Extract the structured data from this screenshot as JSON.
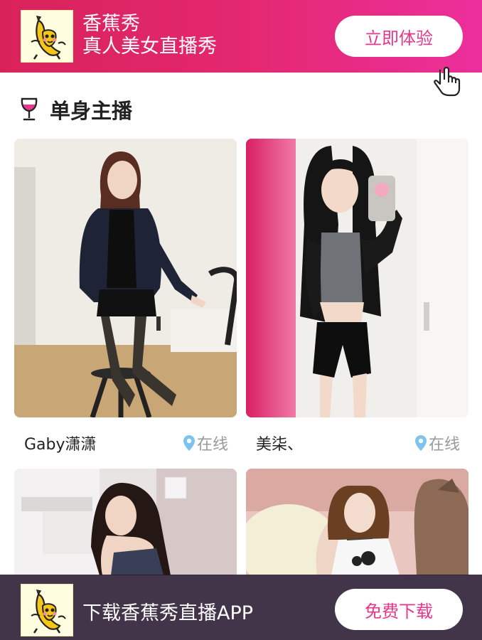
{
  "top_banner": {
    "app_name": "香蕉秀",
    "tagline": "真人美女直播秀",
    "cta_label": "立即体验",
    "logo_icon": "banana-mascot-icon",
    "gradient": [
      "#d9225a",
      "#ec2f9c"
    ]
  },
  "section": {
    "title": "单身主播",
    "icon": "wine-glass-icon"
  },
  "hosts": [
    {
      "name": "Gaby潇潇",
      "status": "在线"
    },
    {
      "name": "美柒、",
      "status": "在线"
    },
    {
      "name": "",
      "status": ""
    },
    {
      "name": "",
      "status": ""
    }
  ],
  "bottom_banner": {
    "text": "下载香蕉秀直播APP",
    "cta_label": "免费下载",
    "logo_icon": "banana-mascot-icon"
  },
  "colors": {
    "accent": "#e8368b",
    "online_pin": "#7cc4ef",
    "status_text": "#9a9a9a"
  }
}
